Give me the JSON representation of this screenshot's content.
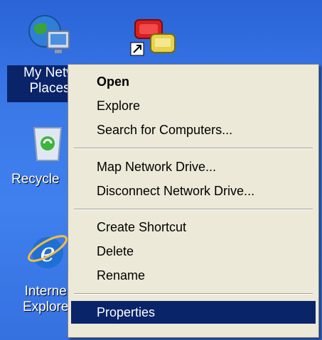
{
  "desktop": {
    "icons": [
      {
        "name": "my-network-places",
        "label_line1": "My Netw",
        "label_line2": "Places"
      },
      {
        "name": "phone-dialer",
        "label_line1": ""
      },
      {
        "name": "recycle-bin",
        "label_line1": "Recycle"
      },
      {
        "name": "internet-explorer",
        "label_line1": "Interne",
        "label_line2": "Explore"
      }
    ]
  },
  "context_menu": {
    "items": [
      {
        "label": "Open",
        "bold": true
      },
      {
        "label": "Explore"
      },
      {
        "label": "Search for Computers..."
      },
      {
        "label": "Map Network Drive..."
      },
      {
        "label": "Disconnect Network Drive..."
      },
      {
        "label": "Create Shortcut"
      },
      {
        "label": "Delete"
      },
      {
        "label": "Rename"
      },
      {
        "label": "Properties",
        "selected": true
      }
    ]
  },
  "colors": {
    "desktop_blue": "#3a78e8",
    "selection_blue": "#0a246a",
    "menu_bg": "#ece9d8"
  }
}
